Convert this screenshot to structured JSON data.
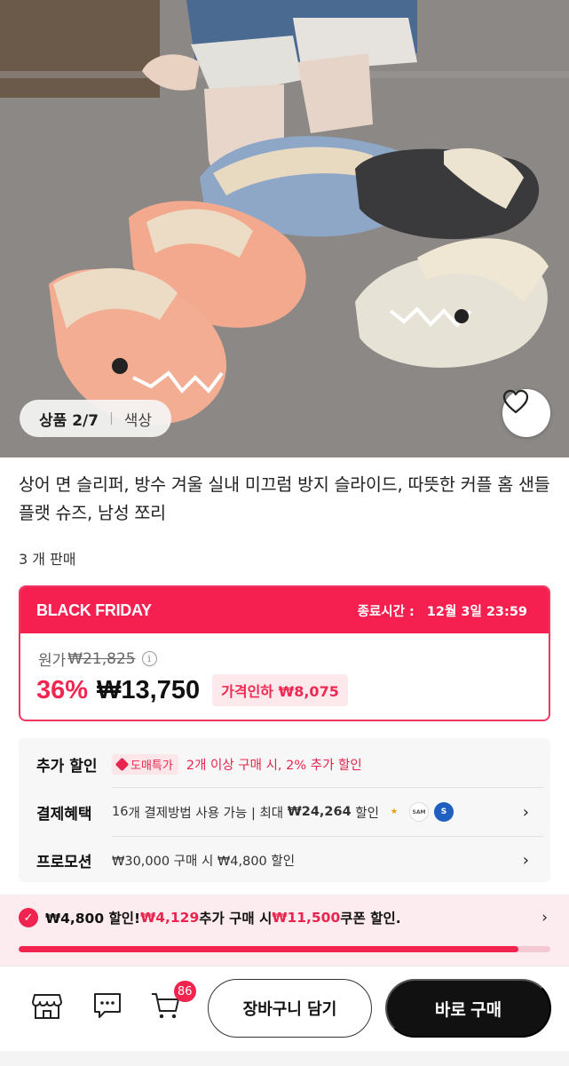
{
  "gallery": {
    "counter_label": "상품 2/7",
    "option_label": "색상"
  },
  "product": {
    "title": "상어 면 슬리퍼, 방수 겨울 실내 미끄럼 방지 슬라이드, 따뜻한 커플 홈 샌들 플랫 슈즈, 남성 쪼리",
    "sold": "3 개 판매"
  },
  "deal": {
    "title": "BLACK FRIDAY",
    "end_label": "종료시간 :",
    "end_time": "12월 3일 23:59",
    "original_label": "원가",
    "original_price": "₩21,825",
    "discount_pct": "36%",
    "price": "₩13,750",
    "price_drop": "가격인하 ₩8,075"
  },
  "benefits": {
    "extra": {
      "label": "추가 할인",
      "tag": "도매특가",
      "text": "2개 이상 구매 시, 2% 추가 할인"
    },
    "payment": {
      "label": "결제혜택",
      "count": "16",
      "text1": "개 결제방법 사용 가능 | 최대 ",
      "max": "₩24,264",
      "text2": " 할인"
    },
    "promotion": {
      "label": "프로모션",
      "text": "₩30,000 구매 시 ₩4,800 할인"
    }
  },
  "promo_bar": {
    "part1": "₩4,800 할인!",
    "part2": "₩4,129",
    "part3": "추가 구매 시",
    "part4": "₩11,500",
    "part5": "쿠폰 할인.",
    "progress": 0.94
  },
  "bottom_bar": {
    "cart_count": "86",
    "add_to_cart": "장바구니 담기",
    "buy_now": "바로 구매"
  },
  "colors": {
    "accent": "#f0244f",
    "deal_header": "#f5204f",
    "buy_button": "#111111"
  }
}
